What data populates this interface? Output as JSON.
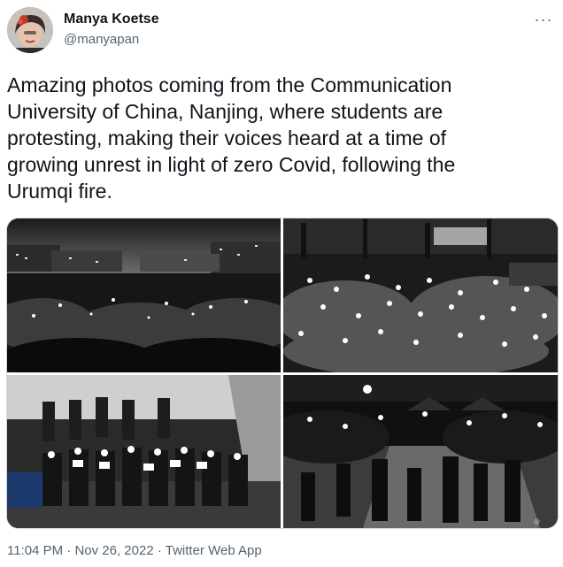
{
  "author": {
    "display_name": "Manya Koetse",
    "handle": "@manyapan"
  },
  "tweet": {
    "text": "Amazing photos coming from the Communication\nUniversity of China, Nanjing, where students are\nprotesting, making their voices heard at a time of\ngrowing unrest in light of zero Covid, following the\nUrumqi fire."
  },
  "meta": {
    "time": "11:04 PM",
    "separator": "·",
    "date": "Nov 26, 2022",
    "source": "Twitter Web App"
  },
  "icons": {
    "more": "more-options-icon"
  },
  "colors": {
    "text_primary": "#0f1419",
    "text_secondary": "#536471",
    "border": "#cfd9de"
  }
}
